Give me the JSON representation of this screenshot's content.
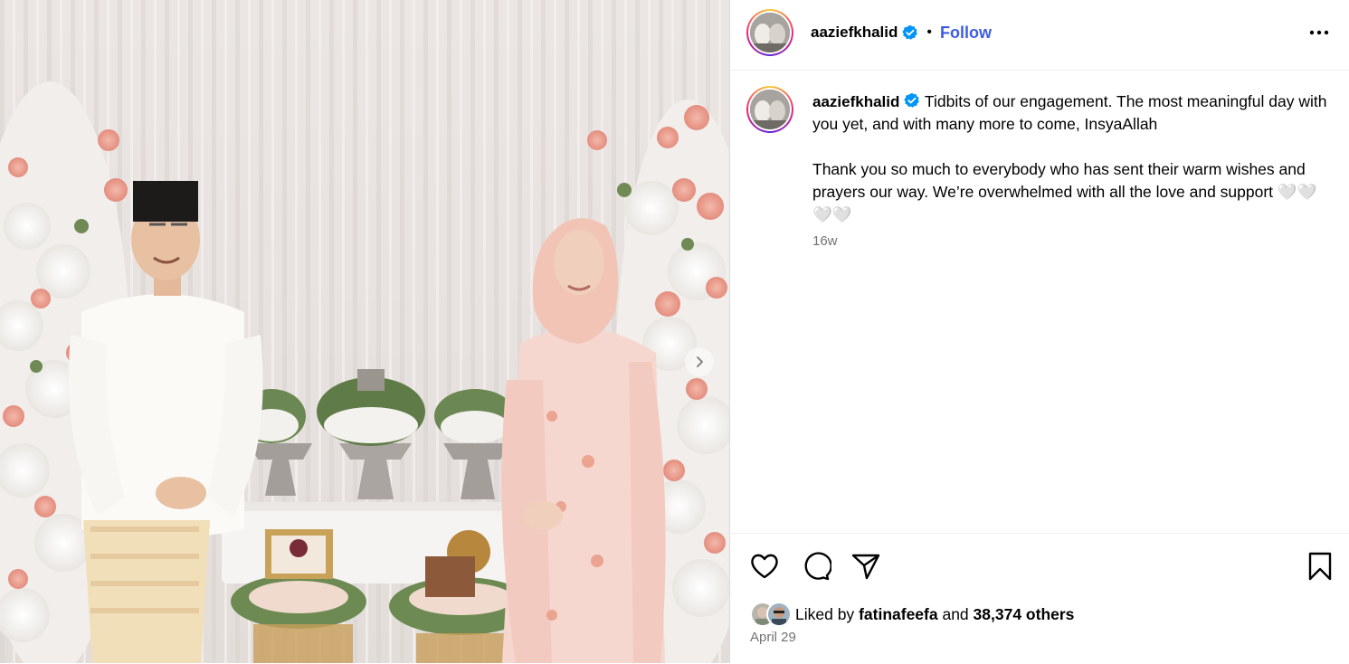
{
  "post": {
    "username": "aaziefkhalid",
    "follow_label": "Follow",
    "separator": "•",
    "caption_line1": "Tidbits of our engagement. The most meaningful day with you yet, and with many more to come, InsyaAllah",
    "caption_line2": "Thank you so much to everybody who has sent their warm wishes and prayers our way. We’re overwhelmed with all the love and support 🤍🤍🤍🤍",
    "time_ago": "16w",
    "liked_by_prefix": "Liked by",
    "liked_by_user": "fatinafeefa",
    "liked_by_and": "and",
    "liked_by_others": "38,374 others",
    "date": "April 29"
  },
  "icons": {
    "verified": "verified-badge-icon",
    "more": "more-options-icon",
    "like": "heart-icon",
    "comment": "comment-icon",
    "share": "share-icon",
    "save": "bookmark-icon",
    "next": "chevron-right-icon"
  },
  "colors": {
    "follow": "#3d5ce6",
    "verified": "#0095f6",
    "muted": "#737373"
  }
}
